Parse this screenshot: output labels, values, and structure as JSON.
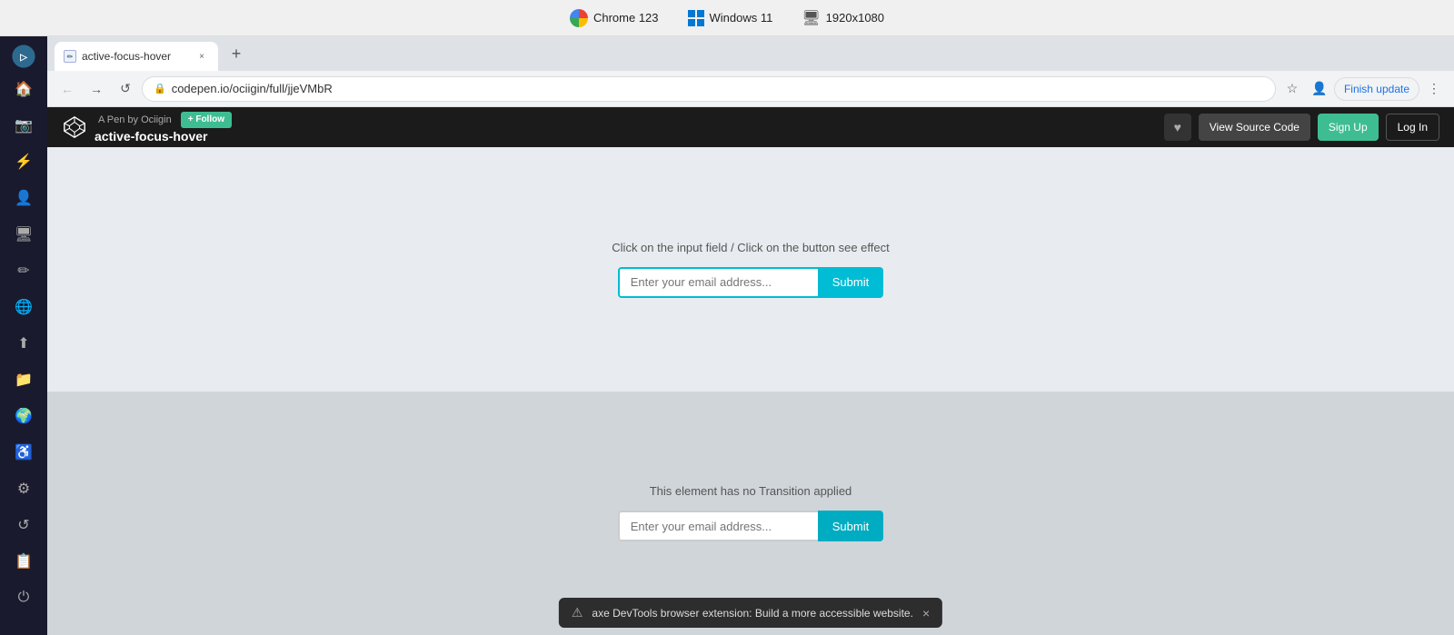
{
  "os_bar": {
    "chrome_label": "Chrome 123",
    "windows_label": "Windows 11",
    "resolution_label": "1920x1080"
  },
  "sidebar": {
    "icons": [
      "⊙",
      "📷",
      "⚡",
      "👤",
      "🖥",
      "✏",
      "🌐",
      "⬆",
      "📁",
      "🌍",
      "♿",
      "⚙",
      "↺",
      "📋",
      "⏻"
    ]
  },
  "browser": {
    "tab": {
      "label": "active-focus-hover",
      "close_label": "×"
    },
    "tab_new_label": "+",
    "nav": {
      "back_label": "←",
      "forward_label": "→",
      "reload_label": "↺",
      "address": "codepen.io/ociigin/full/jjeVMbR",
      "finish_update_label": "Finish update",
      "more_label": "⋮"
    }
  },
  "codepen_header": {
    "pen_by_label": "A Pen by Ociigin",
    "follow_label": "+ Follow",
    "pen_title": "active-focus-hover",
    "heart_icon": "♥",
    "view_source_label": "View Source Code",
    "signup_label": "Sign Up",
    "login_label": "Log In"
  },
  "demo1": {
    "title": "Click on the input field / Click on the button see effect",
    "input_placeholder": "Enter your email address...",
    "submit_label": "Submit"
  },
  "demo2": {
    "title": "This element has no Transition applied",
    "input_placeholder": "Enter your email address...",
    "submit_label": "Submit"
  },
  "notification": {
    "icon": "⚠",
    "text": "axe DevTools browser extension: Build a more accessible website.",
    "close_label": "×"
  },
  "colors": {
    "accent": "#00bcd4",
    "codepen_bg": "#1b1b1b",
    "follow_green": "#3ebd93",
    "sidebar_bg": "#1a1a2e"
  }
}
